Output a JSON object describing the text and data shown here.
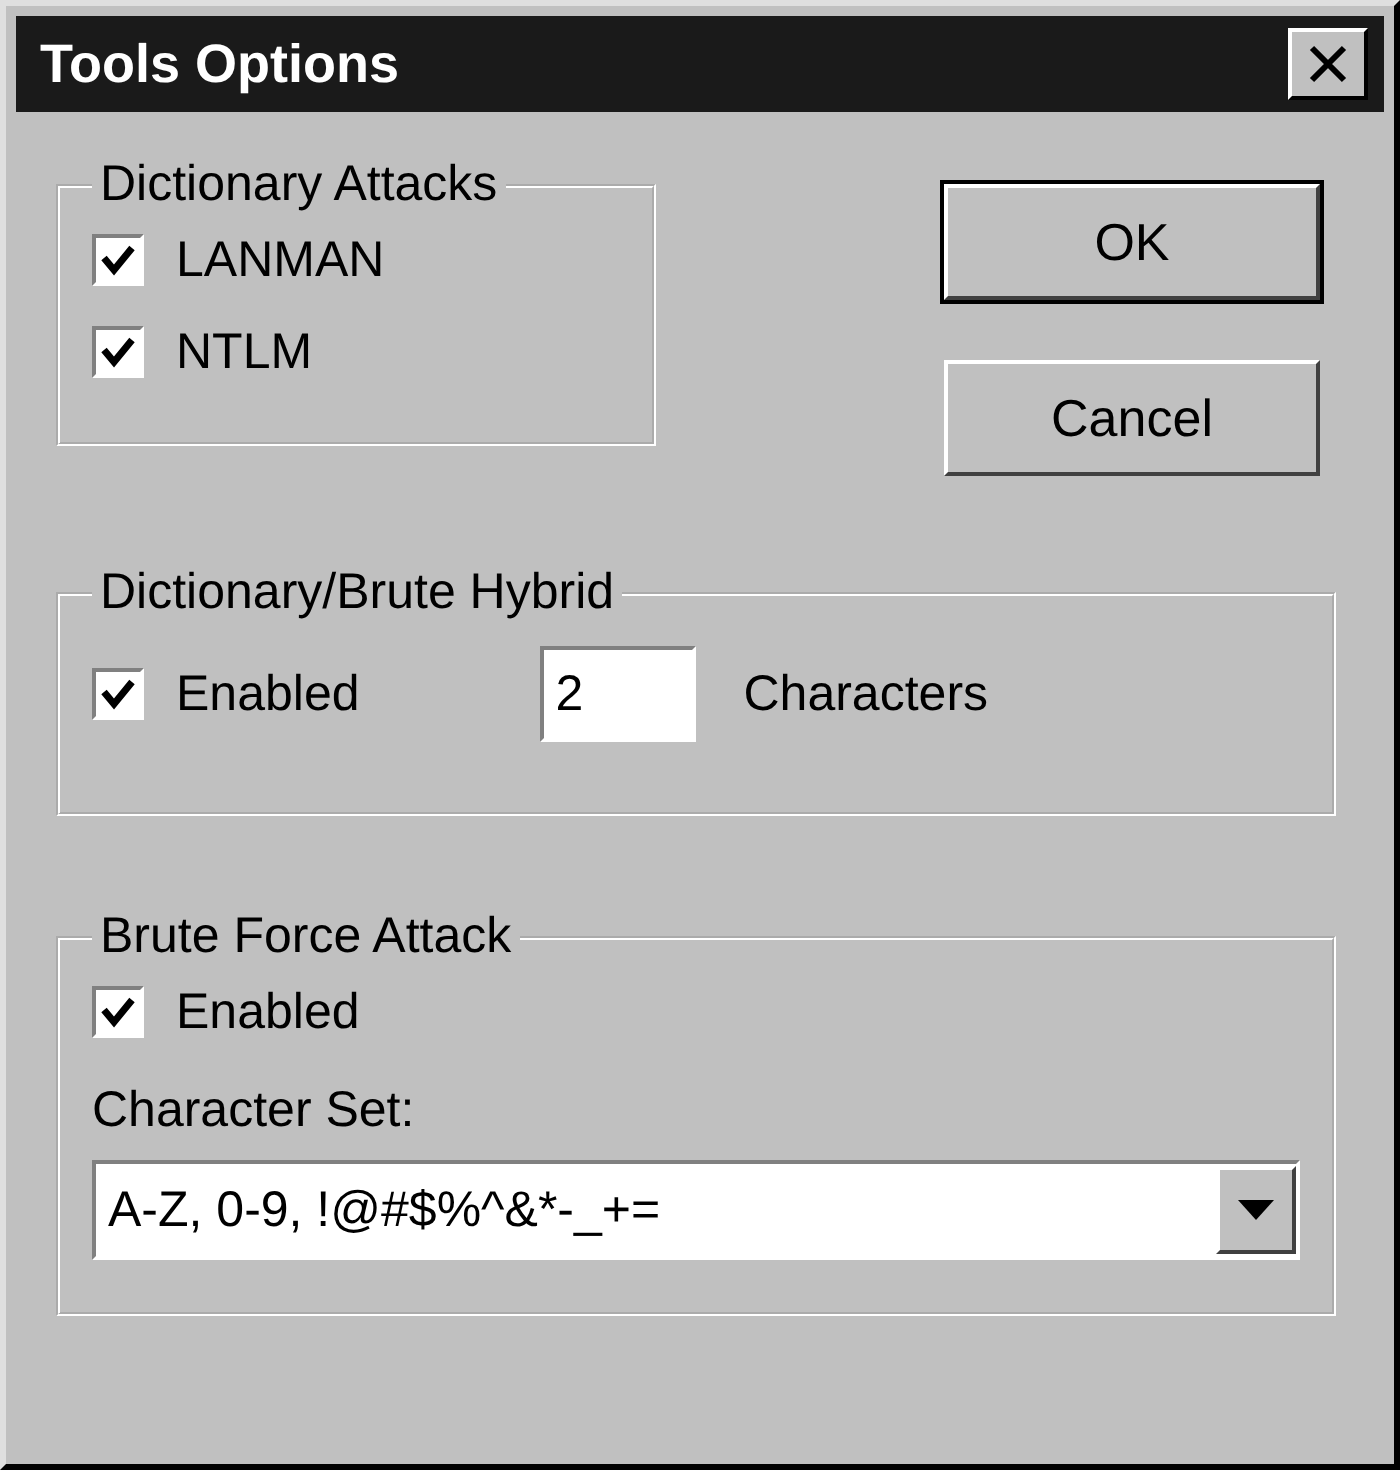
{
  "window": {
    "title": "Tools Options"
  },
  "dictionary_attacks": {
    "label": "Dictionary Attacks",
    "options": [
      {
        "label": "LANMAN",
        "checked": true
      },
      {
        "label": "NTLM",
        "checked": true
      }
    ]
  },
  "buttons": [
    {
      "label": "OK",
      "default": true
    },
    {
      "label": "Cancel",
      "default": false
    }
  ],
  "hybrid": {
    "label": "Dictionary/Brute Hybrid",
    "enabled": {
      "label": "Enabled",
      "checked": true
    },
    "characters": {
      "value": "2",
      "label": "Characters"
    }
  },
  "brute_force": {
    "label": "Brute Force Attack",
    "enabled": {
      "label": "Enabled",
      "checked": true
    },
    "character_set": {
      "label": "Character Set:",
      "value": "A-Z, 0-9, !@#$%^&*-_+="
    }
  }
}
